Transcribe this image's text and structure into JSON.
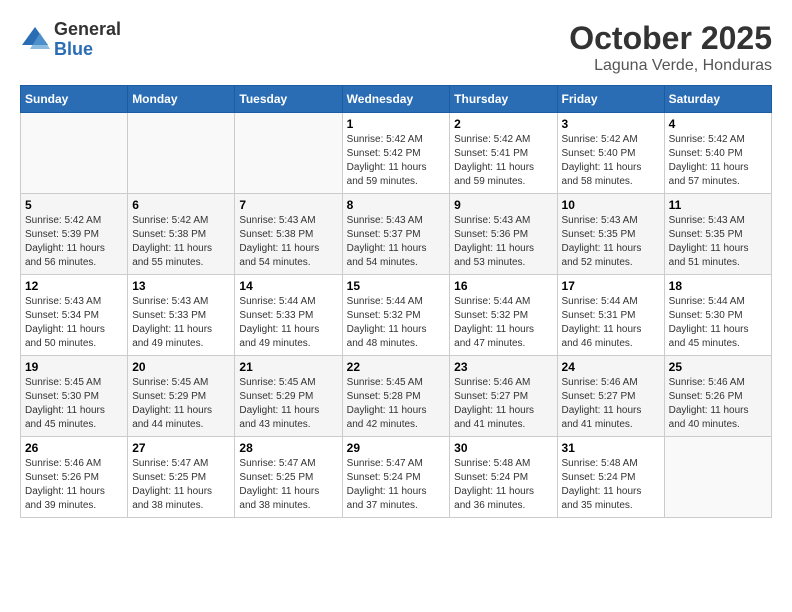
{
  "logo": {
    "general": "General",
    "blue": "Blue"
  },
  "title": "October 2025",
  "location": "Laguna Verde, Honduras",
  "weekdays": [
    "Sunday",
    "Monday",
    "Tuesday",
    "Wednesday",
    "Thursday",
    "Friday",
    "Saturday"
  ],
  "weeks": [
    [
      {
        "day": "",
        "info": ""
      },
      {
        "day": "",
        "info": ""
      },
      {
        "day": "",
        "info": ""
      },
      {
        "day": "1",
        "info": "Sunrise: 5:42 AM\nSunset: 5:42 PM\nDaylight: 11 hours\nand 59 minutes."
      },
      {
        "day": "2",
        "info": "Sunrise: 5:42 AM\nSunset: 5:41 PM\nDaylight: 11 hours\nand 59 minutes."
      },
      {
        "day": "3",
        "info": "Sunrise: 5:42 AM\nSunset: 5:40 PM\nDaylight: 11 hours\nand 58 minutes."
      },
      {
        "day": "4",
        "info": "Sunrise: 5:42 AM\nSunset: 5:40 PM\nDaylight: 11 hours\nand 57 minutes."
      }
    ],
    [
      {
        "day": "5",
        "info": "Sunrise: 5:42 AM\nSunset: 5:39 PM\nDaylight: 11 hours\nand 56 minutes."
      },
      {
        "day": "6",
        "info": "Sunrise: 5:42 AM\nSunset: 5:38 PM\nDaylight: 11 hours\nand 55 minutes."
      },
      {
        "day": "7",
        "info": "Sunrise: 5:43 AM\nSunset: 5:38 PM\nDaylight: 11 hours\nand 54 minutes."
      },
      {
        "day": "8",
        "info": "Sunrise: 5:43 AM\nSunset: 5:37 PM\nDaylight: 11 hours\nand 54 minutes."
      },
      {
        "day": "9",
        "info": "Sunrise: 5:43 AM\nSunset: 5:36 PM\nDaylight: 11 hours\nand 53 minutes."
      },
      {
        "day": "10",
        "info": "Sunrise: 5:43 AM\nSunset: 5:35 PM\nDaylight: 11 hours\nand 52 minutes."
      },
      {
        "day": "11",
        "info": "Sunrise: 5:43 AM\nSunset: 5:35 PM\nDaylight: 11 hours\nand 51 minutes."
      }
    ],
    [
      {
        "day": "12",
        "info": "Sunrise: 5:43 AM\nSunset: 5:34 PM\nDaylight: 11 hours\nand 50 minutes."
      },
      {
        "day": "13",
        "info": "Sunrise: 5:43 AM\nSunset: 5:33 PM\nDaylight: 11 hours\nand 49 minutes."
      },
      {
        "day": "14",
        "info": "Sunrise: 5:44 AM\nSunset: 5:33 PM\nDaylight: 11 hours\nand 49 minutes."
      },
      {
        "day": "15",
        "info": "Sunrise: 5:44 AM\nSunset: 5:32 PM\nDaylight: 11 hours\nand 48 minutes."
      },
      {
        "day": "16",
        "info": "Sunrise: 5:44 AM\nSunset: 5:32 PM\nDaylight: 11 hours\nand 47 minutes."
      },
      {
        "day": "17",
        "info": "Sunrise: 5:44 AM\nSunset: 5:31 PM\nDaylight: 11 hours\nand 46 minutes."
      },
      {
        "day": "18",
        "info": "Sunrise: 5:44 AM\nSunset: 5:30 PM\nDaylight: 11 hours\nand 45 minutes."
      }
    ],
    [
      {
        "day": "19",
        "info": "Sunrise: 5:45 AM\nSunset: 5:30 PM\nDaylight: 11 hours\nand 45 minutes."
      },
      {
        "day": "20",
        "info": "Sunrise: 5:45 AM\nSunset: 5:29 PM\nDaylight: 11 hours\nand 44 minutes."
      },
      {
        "day": "21",
        "info": "Sunrise: 5:45 AM\nSunset: 5:29 PM\nDaylight: 11 hours\nand 43 minutes."
      },
      {
        "day": "22",
        "info": "Sunrise: 5:45 AM\nSunset: 5:28 PM\nDaylight: 11 hours\nand 42 minutes."
      },
      {
        "day": "23",
        "info": "Sunrise: 5:46 AM\nSunset: 5:27 PM\nDaylight: 11 hours\nand 41 minutes."
      },
      {
        "day": "24",
        "info": "Sunrise: 5:46 AM\nSunset: 5:27 PM\nDaylight: 11 hours\nand 41 minutes."
      },
      {
        "day": "25",
        "info": "Sunrise: 5:46 AM\nSunset: 5:26 PM\nDaylight: 11 hours\nand 40 minutes."
      }
    ],
    [
      {
        "day": "26",
        "info": "Sunrise: 5:46 AM\nSunset: 5:26 PM\nDaylight: 11 hours\nand 39 minutes."
      },
      {
        "day": "27",
        "info": "Sunrise: 5:47 AM\nSunset: 5:25 PM\nDaylight: 11 hours\nand 38 minutes."
      },
      {
        "day": "28",
        "info": "Sunrise: 5:47 AM\nSunset: 5:25 PM\nDaylight: 11 hours\nand 38 minutes."
      },
      {
        "day": "29",
        "info": "Sunrise: 5:47 AM\nSunset: 5:24 PM\nDaylight: 11 hours\nand 37 minutes."
      },
      {
        "day": "30",
        "info": "Sunrise: 5:48 AM\nSunset: 5:24 PM\nDaylight: 11 hours\nand 36 minutes."
      },
      {
        "day": "31",
        "info": "Sunrise: 5:48 AM\nSunset: 5:24 PM\nDaylight: 11 hours\nand 35 minutes."
      },
      {
        "day": "",
        "info": ""
      }
    ]
  ]
}
